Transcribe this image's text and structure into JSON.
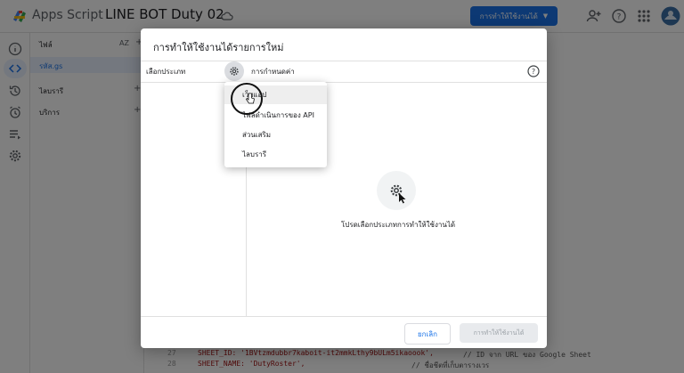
{
  "topbar": {
    "app_name": "Apps Script",
    "project_name": "LINE BOT Duty 02",
    "deploy_label": "การทำให้ใช้งานได้"
  },
  "files_panel": {
    "files_label": "ไฟล์",
    "sort_label": "AZ",
    "file_name": "รหัส.gs",
    "libraries_label": "ไลบรารี",
    "services_label": "บริการ"
  },
  "editor": {
    "lines": [
      {
        "num": "27",
        "code": "SHEET_ID: '1BVtzmdubbr7kaboit-it2mmkLthy9bULm5ikaoook',",
        "comment": "// ID จาก URL ของ Google Sheet"
      },
      {
        "num": "28",
        "code": "SHEET_NAME: 'DutyRoster',",
        "comment": "// ชื่อชีตที่เก็บตารางเวร"
      }
    ]
  },
  "dialog": {
    "title": "การทำให้ใช้งานได้รายการใหม่",
    "select_type_label": "เลือกประเภท",
    "config_label": "การกำหนดค่า",
    "empty_message": "โปรดเลือกประเภทการทำให้ใช้งานได้",
    "cancel_label": "ยกเลิก",
    "deploy_label": "การทำให้ใช้งานได้"
  },
  "menu": {
    "items": [
      {
        "label": "เว็บแอป"
      },
      {
        "label": "ไฟล์ดำเนินการของ API"
      },
      {
        "label": "ส่วนเสริม"
      },
      {
        "label": "ไลบรารี"
      }
    ]
  },
  "colors": {
    "accent": "#1a73e8",
    "overlay": "rgba(0,0,0,0.5)"
  }
}
